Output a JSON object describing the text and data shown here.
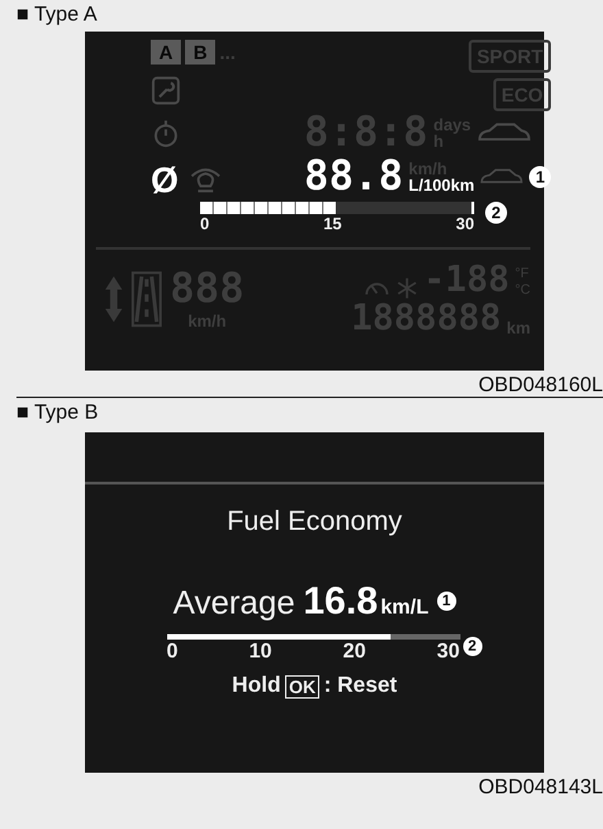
{
  "figures": [
    {
      "kind": "segment_lcd",
      "label": "■ Type A",
      "code": "OBD048160L",
      "trip_tabs": [
        "A",
        "B"
      ],
      "more": "...",
      "drive_modes": [
        "SPORT",
        "ECO"
      ],
      "clock": {
        "digits": "8:8:8",
        "units": [
          "days",
          "h"
        ]
      },
      "symbol": "Ø",
      "reading": "88.8",
      "dim_unit": "km/h",
      "unit": "L/100km",
      "callouts": [
        "1",
        "2"
      ],
      "gauge": {
        "level": 0.5,
        "ticks": [
          "0",
          "15",
          "30"
        ]
      },
      "speed": {
        "digits": "888",
        "unit": "km/h"
      },
      "temperature": {
        "digits": "-188",
        "units": [
          "°F",
          "°C"
        ]
      },
      "odometer": {
        "digits": "1888888",
        "unit": "km"
      }
    },
    {
      "kind": "text_lcd",
      "label": "■ Type B",
      "code": "OBD048143L",
      "title": "Fuel Economy",
      "caption": "Average",
      "reading": "16.8",
      "unit": "km/L",
      "callouts": [
        "1",
        "2"
      ],
      "gauge": {
        "level": 0.75,
        "ticks": [
          "0",
          "10",
          "20",
          "30"
        ]
      },
      "reset": {
        "hold": "Hold",
        "key": "OK",
        "action": ": Reset"
      }
    }
  ]
}
